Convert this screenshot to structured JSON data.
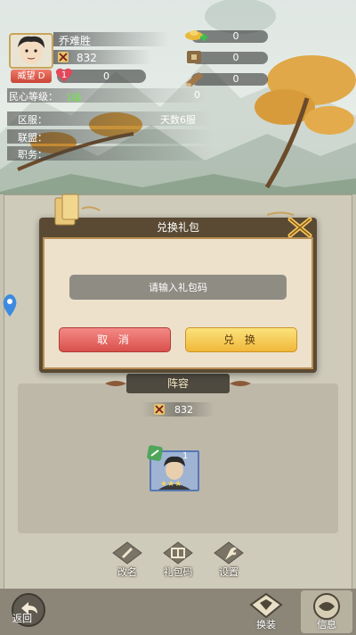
{
  "player": {
    "name": "乔难胜",
    "power": "832",
    "prestige_label": "威望 D",
    "heart_count": "1",
    "heart_value": "0",
    "resources": [
      {
        "icon": "gold-ingot-icon",
        "value": "0"
      },
      {
        "icon": "coin-icon",
        "value": "0"
      },
      {
        "icon": "wood-log-icon",
        "value": "0"
      }
    ],
    "morale_label": "民心等级：",
    "morale_level": "1级",
    "morale_value": "0",
    "server_label": "区服：",
    "server_value": "天数6服",
    "alliance_label": "联盟：",
    "position_label": "职务："
  },
  "dialog": {
    "title": "兑换礼包",
    "input_placeholder": "请输入礼包码",
    "input_value": "",
    "cancel_label": "取 消",
    "confirm_label": "兑 换"
  },
  "lineup": {
    "title": "阵容",
    "power": "832",
    "hero_level": "1",
    "hero_stars": "★★★"
  },
  "actions": [
    {
      "label": "改名",
      "icon": "rename-icon"
    },
    {
      "label": "礼包码",
      "icon": "gift-code-icon"
    },
    {
      "label": "设置",
      "icon": "settings-icon"
    }
  ],
  "bottom": {
    "back_label": "返回",
    "tabs": [
      {
        "label": "换装",
        "icon": "outfit-icon"
      },
      {
        "label": "信息",
        "icon": "info-icon"
      }
    ]
  },
  "colors": {
    "cancel": "#d9504b",
    "confirm": "#f0b83a",
    "level_green": "#6fe34a",
    "gold_border": "#b88d53"
  }
}
